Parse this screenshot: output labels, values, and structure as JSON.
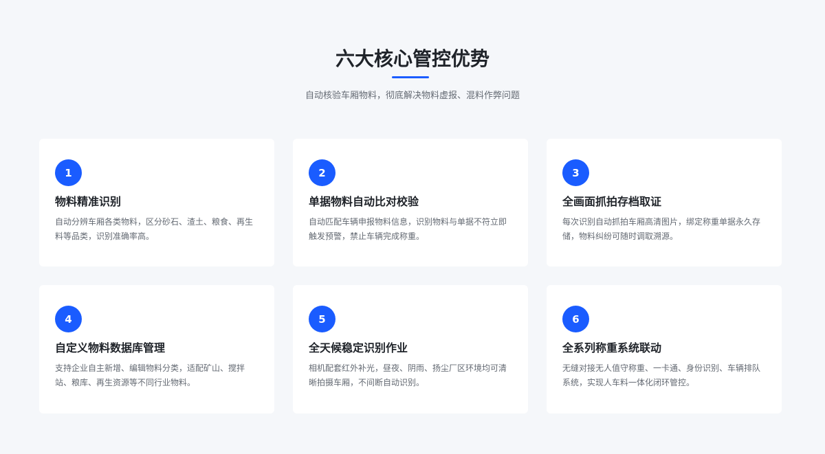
{
  "header": {
    "title": "六大核心管控优势",
    "subtitle": "自动核验车厢物料，彻底解决物料虚报、混料作弊问题"
  },
  "colors": {
    "accent": "#1a5cff",
    "background": "#f5f7fa",
    "card": "#ffffff",
    "title_text": "#1f2329",
    "body_text": "#646a73"
  },
  "features": [
    {
      "number": "1",
      "title": "物料精准识别",
      "desc": "自动分辨车厢各类物料，区分砂石、渣土、粮食、再生料等品类，识别准确率高。"
    },
    {
      "number": "2",
      "title": "单据物料自动比对校验",
      "desc": "自动匹配车辆申报物料信息，识别物料与单据不符立即触发预警，禁止车辆完成称重。"
    },
    {
      "number": "3",
      "title": "全画面抓拍存档取证",
      "desc": "每次识别自动抓拍车厢高清图片，绑定称重单据永久存储，物料纠纷可随时调取溯源。"
    },
    {
      "number": "4",
      "title": "自定义物料数据库管理",
      "desc": "支持企业自主新增、编辑物料分类，适配矿山、搅拌站、粮库、再生资源等不同行业物料。"
    },
    {
      "number": "5",
      "title": "全天候稳定识别作业",
      "desc": "相机配套红外补光，昼夜、阴雨、扬尘厂区环境均可清晰拍摄车厢，不间断自动识别。"
    },
    {
      "number": "6",
      "title": "全系列称重系统联动",
      "desc": "无缝对接无人值守称重、一卡通、身份识别、车辆排队系统，实现人车料一体化闭环管控。"
    }
  ]
}
